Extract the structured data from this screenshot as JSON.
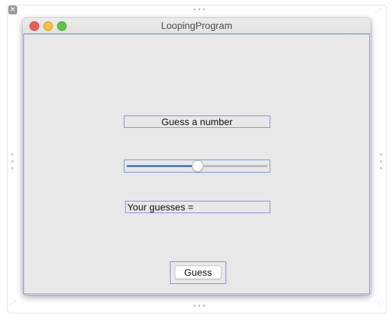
{
  "window": {
    "title": "LoopingProgram"
  },
  "labels": {
    "prompt": "Guess a number",
    "guesses": "Your guesses ="
  },
  "slider": {
    "level": 0.5
  },
  "buttons": {
    "guess": "Guess"
  },
  "icons": {
    "canvas_close": "close-icon",
    "handle": "resize-handle-icon"
  },
  "colors": {
    "selection_outline": "#7f8fd6",
    "slider_fill": "#4e7cc5",
    "close_red": "#ee5c56",
    "minimize_yellow": "#f5be3b",
    "zoom_green": "#5ec547"
  }
}
